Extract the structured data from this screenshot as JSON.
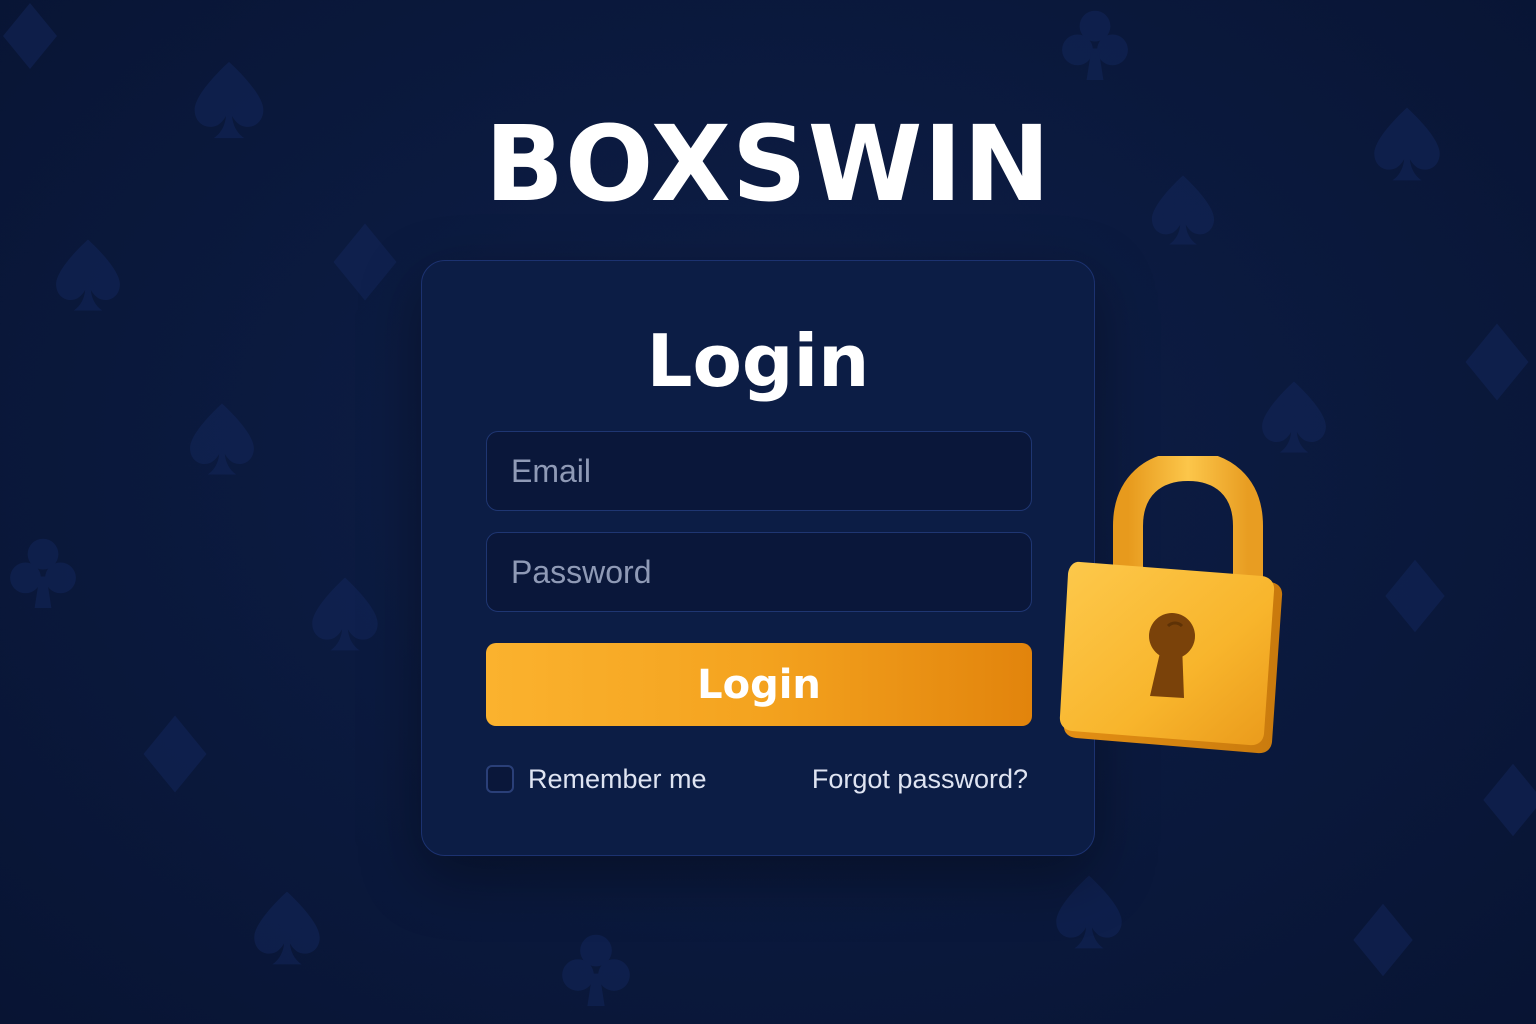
{
  "brand": {
    "name": "BOXSWIN"
  },
  "login_card": {
    "title": "Login",
    "email_field": {
      "placeholder": "Email",
      "value": ""
    },
    "password_field": {
      "placeholder": "Password",
      "value": ""
    },
    "submit_label": "Login",
    "remember_me": {
      "label": "Remember me",
      "checked": false
    },
    "forgot_password_label": "Forgot password?"
  },
  "decorations": {
    "side_icon": "padlock-icon",
    "background_pattern": "card-suits-pattern"
  },
  "colors": {
    "background": "#0b1a3f",
    "card_background": "#0c1d45",
    "card_border": "#1c3270",
    "button_gradient_start": "#fbb22e",
    "button_gradient_end": "#e2840c",
    "padlock": "#f8b92e",
    "text_primary": "#ffffff",
    "placeholder": "#8f9ab6"
  }
}
